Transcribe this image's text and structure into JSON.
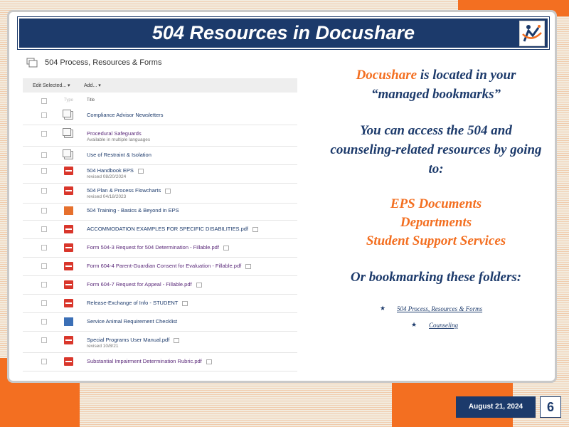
{
  "title": "504 Resources in Docushare",
  "breadcrumb": "504 Process, Resources & Forms",
  "toolbar": {
    "edit_selected": "Edit Selected...",
    "add": "Add..."
  },
  "table_header": {
    "type": "Type",
    "title": "Title"
  },
  "rows": [
    {
      "name": "Compliance Advisor Newsletters",
      "sub": ""
    },
    {
      "name": "Procedural Safeguards",
      "sub": "Available in multiple languages"
    },
    {
      "name": "Use of Restraint & Isolation",
      "sub": ""
    },
    {
      "name": "504 Handbook EPS",
      "sub": "revised 08/20/2024"
    },
    {
      "name": "504 Plan & Process Flowcharts",
      "sub": "revised 04/18/2023"
    },
    {
      "name": "504 Training - Basics & Beyond in EPS",
      "sub": ""
    },
    {
      "name": "ACCOMMODATION EXAMPLES FOR SPECIFIC DISABILITIES.pdf",
      "sub": ""
    },
    {
      "name": "Form 504-3 Request for 504 Determination - Fillable.pdf",
      "sub": ""
    },
    {
      "name": "Form 604-4 Parent-Guardian Consent for Evaluation - Fillable.pdf",
      "sub": ""
    },
    {
      "name": "Form 604-7 Request for Appeal - Fillable.pdf",
      "sub": ""
    },
    {
      "name": "Release-Exchange of Info - STUDENT",
      "sub": ""
    },
    {
      "name": "Service Animal Requirement Checklist",
      "sub": ""
    },
    {
      "name": "Special Programs User Manual.pdf",
      "sub": "revised 10/8/21"
    },
    {
      "name": "Substantial Impairment Determination Rubric.pdf",
      "sub": ""
    }
  ],
  "right": {
    "line1_orange": "Docushare",
    "line1_rest": " is located in your",
    "line2": "“managed bookmarks”",
    "para2_l1": "You can access the 504 and",
    "para2_l2": "counseling-related resources by going",
    "para2_l3": "to:",
    "bullet_glyph": "",
    "bullets": [
      "EPS Documents",
      "Departments",
      "Student Support Services"
    ],
    "or_line": "Or bookmarking these folders:",
    "star_glyph": "★",
    "folder_links": [
      "504 Process, Resources & Forms",
      "Counseling"
    ]
  },
  "footer": {
    "date": "August 21, 2024",
    "page": "6"
  }
}
